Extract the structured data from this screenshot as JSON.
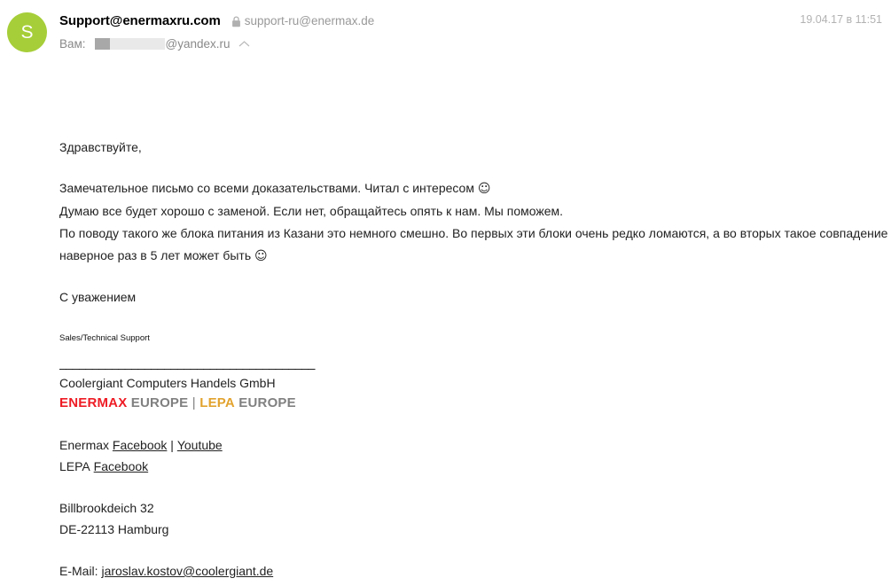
{
  "header": {
    "avatar_initial": "S",
    "avatar_color": "#a6ce39",
    "sender_name": "Support@enermaxru.com",
    "sender_address": "support-ru@enermax.de",
    "lock_icon": "lock-icon",
    "recipient_label": "Вам:",
    "recipient_domain": "@yandex.ru",
    "collapse_icon": "chevron-up-icon",
    "timestamp": "19.04.17 в 11:51"
  },
  "body": {
    "greeting": "Здравствуйте,",
    "paragraph_1": "Замечательное письмо со всеми доказательствами. Читал с интересом ",
    "smiley_1": "☺",
    "paragraph_2": "Думаю все будет хорошо с заменой. Если нет, обращайтесь опять к нам. Мы поможем.",
    "paragraph_3": "По поводу такого же блока питания из Казани это немного смешно. Во первых эти блоки очень редко ломаются, а во вторых такое совпадение наверное раз в 5 лет может быть ",
    "smiley_2": "☺",
    "closing": "С уважением"
  },
  "signature": {
    "role": "Sales/Technical Support",
    "divider": "_______________________________________",
    "company": "Coolergiant Computers Handels GmbH",
    "brand_enermax": "ENERMAX",
    "brand_enermax_suffix": "EUROPE",
    "brand_separator": "|",
    "brand_lepa": "LEPA",
    "brand_lepa_suffix": "EUROPE",
    "social": {
      "enermax_prefix": "Enermax",
      "enermax_facebook": "Facebook",
      "social_separator": "|",
      "enermax_youtube": "Youtube",
      "lepa_prefix": "LEPA",
      "lepa_facebook": "Facebook"
    },
    "address_street": "Billbrookdeich 32",
    "address_city": "DE-22113 Hamburg",
    "email_label": "E-Mail:",
    "email_value": "jaroslav.kostov@coolergiant.de"
  },
  "colors": {
    "avatar_green": "#a6ce39",
    "enermax_red": "#ee1c25",
    "lepa_amber": "#e2a32e",
    "europe_gray": "#808080",
    "meta_gray": "#999999",
    "timestamp_gray": "#b2b2b2"
  }
}
